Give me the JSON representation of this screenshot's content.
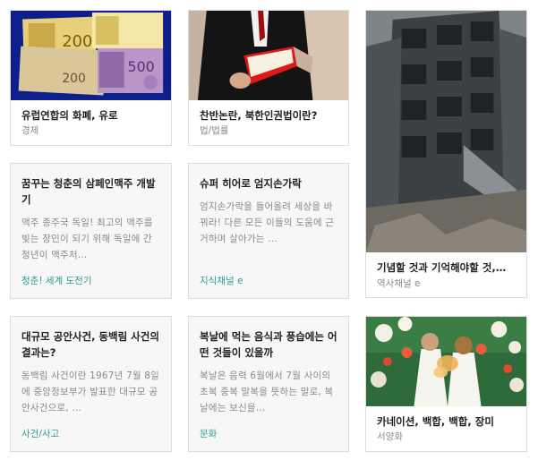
{
  "cards": [
    {
      "title": "유럽연합의 화폐, 유로",
      "category": "경제",
      "image": "euro-banknotes"
    },
    {
      "title": "찬반논란, 북한인권법이란?",
      "category": "법/법률",
      "image": "person-reading-red-book"
    },
    {
      "title": "기념할 것과 기억해야할 것,…",
      "category": "역사채널 e",
      "image": "ruined-building"
    },
    {
      "title": "꿈꾸는 청춘의 삼페인맥주 개발기",
      "description": "맥주 종주국 독일! 최고의 맥주를 빚는 장인이 되기 위해 독일에 간 청년이 맥주처…",
      "category": "청춘! 세계 도전기"
    },
    {
      "title": "슈퍼 히어로 엄지손가락",
      "description": "엄지손가락을 들어올려 세상을 바꿔라! 다른 모든 이들의 도움에 근거하며 살아가는 …",
      "category": "지식채널 e"
    },
    {
      "title": "대규모 공안사건, 동백림 사건의 결과는?",
      "description": "동백림 사건이란 1967년 7월 8일에 중앙정보부가 발표한 대규모 공안사건으로, …",
      "category": "사건/사고"
    },
    {
      "title": "복날에 먹는 음식과 풍습에는 어떤 것들이 있을까",
      "description": "복날은 음력 6월에서 7월 사이의 초복 중복 말복을 뜻하는 말로, 복날에는 보신을…",
      "category": "문화"
    },
    {
      "title": "카네이션, 백합, 백합, 장미",
      "category": "서양화",
      "image": "children-with-flowers"
    }
  ],
  "colors": {
    "category_accent": "#2a9c8f",
    "title": "#222222",
    "meta": "#8a8a8a"
  }
}
